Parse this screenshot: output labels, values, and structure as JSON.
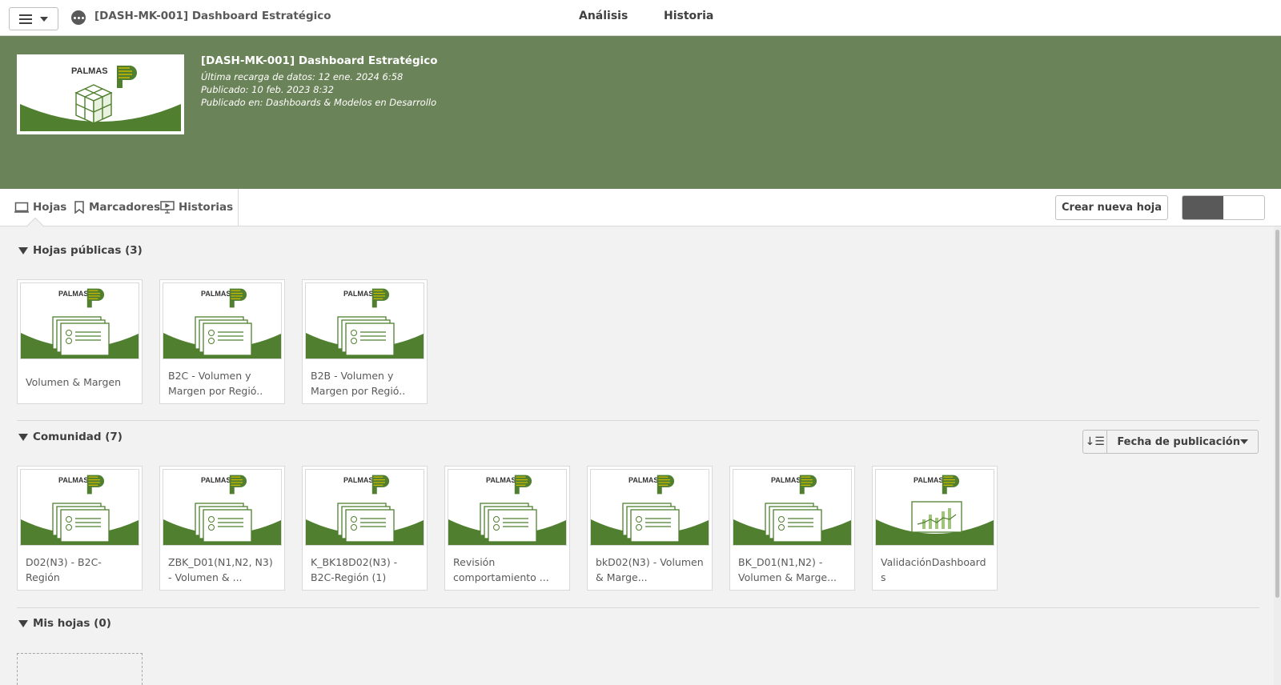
{
  "header": {
    "app_title": "[DASH-MK-001] Dashboard Estratégico",
    "tabs": [
      "Análisis",
      "Historia"
    ]
  },
  "banner": {
    "title": "[DASH-MK-001] Dashboard Estratégico",
    "last_reload": "Última recarga de datos: 12 ene. 2024 6:58",
    "published": "Publicado: 10 feb. 2023 8:32",
    "published_in": "Publicado en: Dashboards & Modelos en Desarrollo",
    "logo_text": "PALMAS"
  },
  "toolbar": {
    "tabs": [
      "Hojas",
      "Marcadores",
      "Historias"
    ],
    "new_sheet_label": "Crear nueva hoja"
  },
  "sections": {
    "public": {
      "label": "Hojas públicas (3)",
      "cards": [
        "Volumen & Margen",
        "B2C - Volumen y Margen por Regió..",
        "B2B - Volumen y Margen por Regió.."
      ]
    },
    "community": {
      "label": "Comunidad (7)",
      "sort_label": "Fecha de publicación",
      "cards": [
        "D02(N3) - B2C-Región",
        "ZBK_D01(N1,N2, N3) - Volumen & ...",
        "K_BK18D02(N3) - B2C-Región (1)",
        "Revisión comportamiento ...",
        "bkD02(N3) - Volumen & Marge...",
        "BK_D01(N1,N2) - Volumen & Marge...",
        "ValidaciónDashboards"
      ]
    },
    "mine": {
      "label": "Mis hojas (0)"
    }
  },
  "colors": {
    "banner": "#6b8358",
    "brand_green": "#4f7f2f",
    "logo_yellow": "#c9b800"
  }
}
